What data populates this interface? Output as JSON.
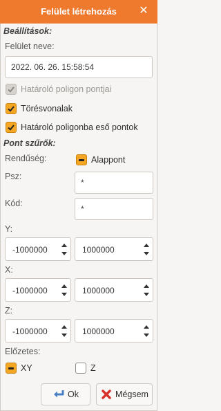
{
  "window": {
    "title": "Felület létrehozás",
    "close_glyph": "✕"
  },
  "settings": {
    "section_title": "Beállítások:",
    "surface_name_label": "Felület neve:",
    "surface_name_value": "2022. 06. 26. 15:58:54",
    "boundary_points_label": "Határoló poligon pontjai",
    "boundary_points_checked": true,
    "boundary_points_enabled": false,
    "breaklines_label": "Törésvonalak",
    "breaklines_checked": true,
    "inside_points_label": "Határoló poligonba eső pontok",
    "inside_points_checked": true
  },
  "filters": {
    "section_title": "Pont szűrők:",
    "order_label": "Rendűség:",
    "order_option_label": "Alappont",
    "psz_label": "Psz:",
    "psz_value": "*",
    "code_label": "Kód:",
    "code_value": "*",
    "y_label": "Y:",
    "y_min": "-1000000",
    "y_max": "1000000",
    "x_label": "X:",
    "x_min": "-1000000",
    "x_max": "1000000",
    "z_label": "Z:",
    "z_min": "-1000000",
    "z_max": "1000000"
  },
  "preview": {
    "label": "Előzetes:",
    "xy_label": "XY",
    "z_label": "Z"
  },
  "buttons": {
    "ok_label": "Ok",
    "cancel_label": "Mégsem"
  },
  "colors": {
    "accent": "#ef7a2d",
    "checkbox_on": "#f5a623"
  }
}
